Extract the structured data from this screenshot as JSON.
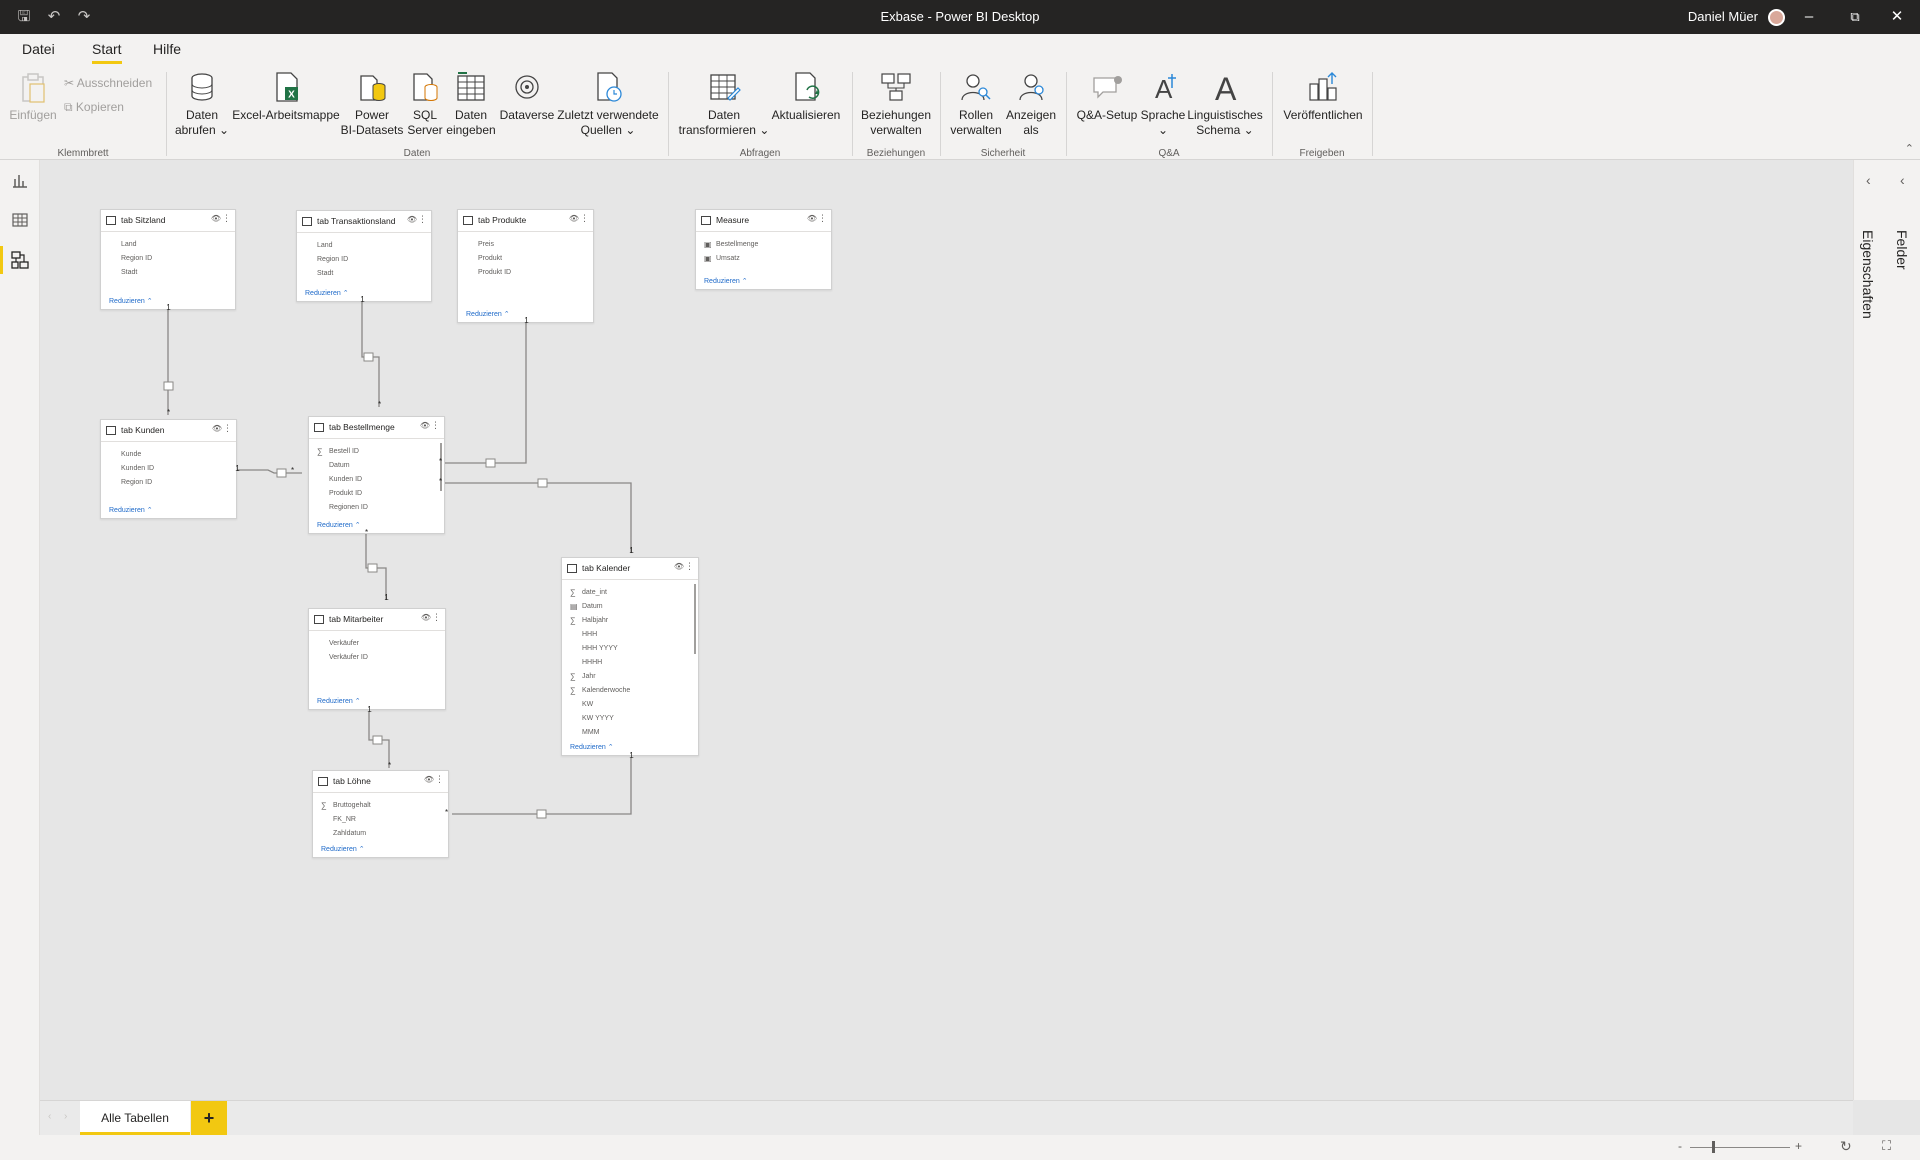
{
  "window": {
    "title": "Exbase - Power BI Desktop",
    "user_name": "Daniel Müer"
  },
  "menu": {
    "tabs": [
      "Datei",
      "Start",
      "Hilfe"
    ],
    "active": "Start"
  },
  "ribbon": {
    "groups": {
      "clipboard": "Klemmbrett",
      "data": "Daten",
      "queries": "Abfragen",
      "relations": "Beziehungen",
      "security": "Sicherheit",
      "qa": "Q&A",
      "share": "Freigeben"
    },
    "buttons": {
      "paste": "Einfügen",
      "cut": "Ausschneiden",
      "copy": "Kopieren",
      "get_data_1": "Daten",
      "get_data_2": "abrufen",
      "excel": "Excel-Arbeitsmappe",
      "pbi_datasets_1": "Power",
      "pbi_datasets_2": "BI-Datasets",
      "sql_1": "SQL",
      "sql_2": "Server",
      "enter_data_1": "Daten",
      "enter_data_2": "eingeben",
      "dataverse": "Dataverse",
      "recent_1": "Zuletzt verwendete",
      "recent_2": "Quellen",
      "transform_1": "Daten",
      "transform_2": "transformieren",
      "refresh": "Aktualisieren",
      "manage_rel_1": "Beziehungen",
      "manage_rel_2": "verwalten",
      "manage_roles_1": "Rollen",
      "manage_roles_2": "verwalten",
      "view_as_1": "Anzeigen",
      "view_as_2": "als",
      "qa_setup": "Q&A-Setup",
      "language": "Sprache",
      "ling_1": "Linguistisches",
      "ling_2": "Schema",
      "publish": "Veröffentlichen"
    }
  },
  "side_panes": {
    "properties": "Eigenschaften",
    "fields": "Felder"
  },
  "model": {
    "collapse_label": "Reduzieren",
    "tables": [
      {
        "id": "sitzland",
        "title": "tab Sitzland",
        "fields": [
          "Land",
          "Region ID",
          "Stadt"
        ]
      },
      {
        "id": "transaktionsland",
        "title": "tab Transaktionsland",
        "fields": [
          "Land",
          "Region ID",
          "Stadt"
        ]
      },
      {
        "id": "produkte",
        "title": "tab Produkte",
        "fields": [
          "Preis",
          "Produkt",
          "Produkt ID"
        ]
      },
      {
        "id": "measure",
        "title": "Measure",
        "fields": [
          "Bestellmenge",
          "Umsatz"
        ]
      },
      {
        "id": "kunden",
        "title": "tab Kunden",
        "fields": [
          "Kunde",
          "Kunden ID",
          "Region ID"
        ]
      },
      {
        "id": "bestellmenge",
        "title": "tab Bestellmenge",
        "fields": [
          "Bestell ID",
          "Datum",
          "Kunden ID",
          "Produkt ID",
          "Regionen ID"
        ]
      },
      {
        "id": "kalender",
        "title": "tab Kalender",
        "fields": [
          "date_int",
          "Datum",
          "Halbjahr",
          "HHH",
          "HHH YYYY",
          "HHHH",
          "Jahr",
          "Kalenderwoche",
          "KW",
          "KW YYYY",
          "MMM"
        ]
      },
      {
        "id": "mitarbeiter",
        "title": "tab Mitarbeiter",
        "fields": [
          "Verkäufer",
          "Verkäufer ID"
        ]
      },
      {
        "id": "loehne",
        "title": "tab Löhne",
        "fields": [
          "Bruttogehalt",
          "FK_NR",
          "Zahldatum"
        ]
      }
    ],
    "cardinality": {
      "one": "1",
      "many": "*"
    }
  },
  "pages": {
    "tabs": [
      "Alle Tabellen"
    ],
    "add": "+"
  },
  "status": {
    "zoom_minus": "-",
    "zoom_plus": "+"
  }
}
